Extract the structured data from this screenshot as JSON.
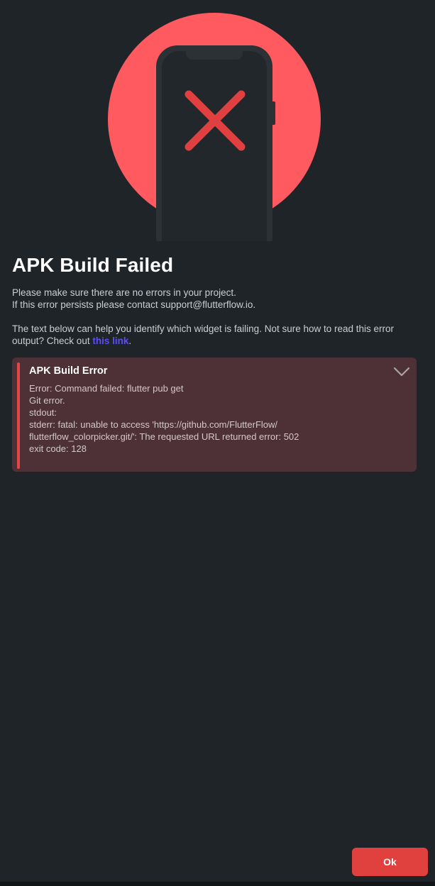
{
  "hero": {
    "illustration_icon": "phone-error-icon",
    "circle_color": "#ff5a5f",
    "phone_color": "#25292e",
    "x_color": "#e0403f"
  },
  "dialog": {
    "title": "APK Build Failed",
    "description_line1": "Please make sure there are no errors in your project.",
    "description_line2": "If this error persists please contact support@flutterflow.io.",
    "help_text": "The text below can help you identify which widget is failing. Not sure how to read this error output? Check out ",
    "help_link": "this link",
    "help_suffix": "."
  },
  "error_panel": {
    "title": "APK Build Error",
    "expand_icon": "chevron-down-icon",
    "accent_color": "#e04747",
    "lines": [
      "Error: Command failed: flutter pub get",
      "Git error.",
      "stdout:",
      "stderr: fatal: unable to access 'https://github.com/FlutterFlow/",
      "flutterflow_colorpicker.git/': The requested URL returned error: 502",
      "exit code: 128"
    ]
  },
  "actions": {
    "ok_label": "Ok",
    "ok_color": "#e0413f"
  }
}
